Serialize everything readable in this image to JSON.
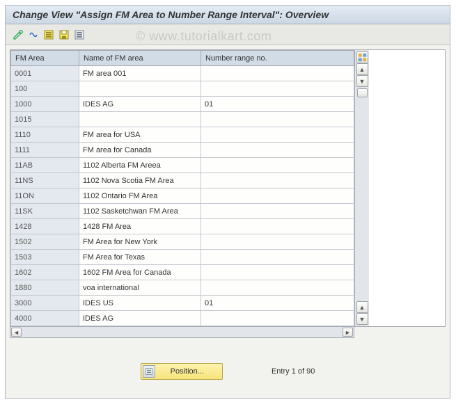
{
  "title": "Change View \"Assign FM Area to Number Range Interval\": Overview",
  "watermark": "© www.tutorialkart.com",
  "toolbar": {
    "icons": [
      "toggle-display-change",
      "change-selected",
      "select-all",
      "save",
      "deselect-all"
    ]
  },
  "columns": {
    "fm_area": "FM Area",
    "name": "Name of FM area",
    "nr": "Number range no."
  },
  "rows": [
    {
      "fm_area": "0001",
      "name": "FM area 001",
      "nr": ""
    },
    {
      "fm_area": "100",
      "name": "",
      "nr": ""
    },
    {
      "fm_area": "1000",
      "name": "IDES AG",
      "nr": "01"
    },
    {
      "fm_area": "1015",
      "name": "",
      "nr": ""
    },
    {
      "fm_area": "1110",
      "name": "FM area for USA",
      "nr": ""
    },
    {
      "fm_area": "1111",
      "name": "FM area for Canada",
      "nr": ""
    },
    {
      "fm_area": "11AB",
      "name": "1102 Alberta FM Areea",
      "nr": ""
    },
    {
      "fm_area": "11NS",
      "name": "1102 Nova Scotia FM Area",
      "nr": ""
    },
    {
      "fm_area": "11ON",
      "name": "1102 Ontario FM Area",
      "nr": ""
    },
    {
      "fm_area": "11SK",
      "name": "1102 Sasketchwan FM Area",
      "nr": ""
    },
    {
      "fm_area": "1428",
      "name": "1428 FM Area",
      "nr": ""
    },
    {
      "fm_area": "1502",
      "name": "FM Area for New York",
      "nr": ""
    },
    {
      "fm_area": "1503",
      "name": "FM Area for Texas",
      "nr": ""
    },
    {
      "fm_area": "1602",
      "name": "1602 FM Area for Canada",
      "nr": ""
    },
    {
      "fm_area": "1880",
      "name": "voa international",
      "nr": ""
    },
    {
      "fm_area": "3000",
      "name": "IDES US",
      "nr": "01"
    },
    {
      "fm_area": "4000",
      "name": "IDES AG",
      "nr": ""
    }
  ],
  "footer": {
    "position_label": "Position...",
    "entry_text": "Entry 1 of 90"
  }
}
